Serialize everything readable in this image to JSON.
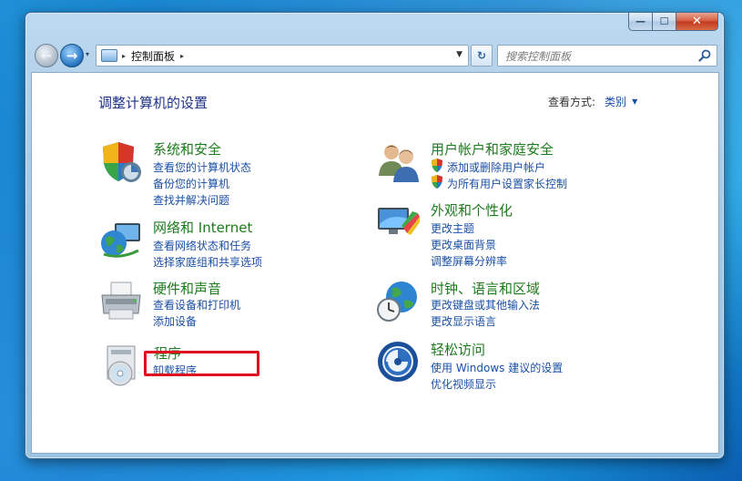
{
  "window": {
    "minimize_glyph": "—",
    "maximize_glyph": "☐",
    "close_glyph": "✕"
  },
  "navigation": {
    "back_glyph": "←",
    "forward_glyph": "→",
    "history_glyph": "▾",
    "address": {
      "separator": "▸",
      "path": "控制面板",
      "dropdown_glyph": "▼"
    },
    "refresh_glyph": "↻",
    "search": {
      "placeholder": "搜索控制面板"
    }
  },
  "content": {
    "title": "调整计算机的设置",
    "view_by": {
      "label": "查看方式:",
      "value": "类别"
    }
  },
  "left_categories": [
    {
      "icon": "shield-check-icon",
      "title": "系统和安全",
      "links": [
        "查看您的计算机状态",
        "备份您的计算机",
        "查找并解决问题"
      ]
    },
    {
      "icon": "network-globe-icon",
      "title": "网络和 Internet",
      "links": [
        "查看网络状态和任务",
        "选择家庭组和共享选项"
      ]
    },
    {
      "icon": "printer-icon",
      "title": "硬件和声音",
      "links": [
        "查看设备和打印机",
        "添加设备"
      ]
    },
    {
      "icon": "programs-disc-icon",
      "title": "程序",
      "links": [
        "卸载程序"
      ]
    }
  ],
  "right_categories": [
    {
      "icon": "users-icon",
      "title": "用户帐户和家庭安全",
      "links": [
        "添加或删除用户帐户",
        "为所有用户设置家长控制"
      ]
    },
    {
      "icon": "monitor-palette-icon",
      "title": "外观和个性化",
      "links": [
        "更改主题",
        "更改桌面背景",
        "调整屏幕分辨率"
      ]
    },
    {
      "icon": "clock-globe-icon",
      "title": "时钟、语言和区域",
      "links": [
        "更改键盘或其他输入法",
        "更改显示语言"
      ]
    },
    {
      "icon": "ease-of-access-icon",
      "title": "轻松访问",
      "links": [
        "使用 Windows 建议的设置",
        "优化视频显示"
      ]
    }
  ],
  "colors": {
    "category_title": "#1d7a1d",
    "link": "#1a4fa5",
    "title": "#1e3287",
    "highlight": "#e0101e"
  }
}
